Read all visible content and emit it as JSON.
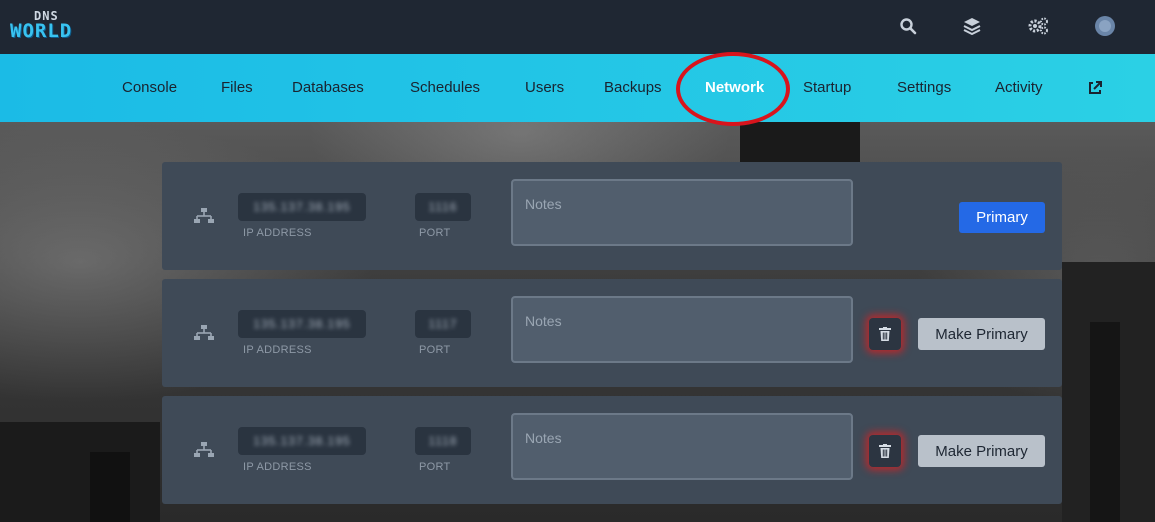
{
  "logo": {
    "line1": "DNS",
    "line2": "WORLD"
  },
  "topbar": {
    "icons": [
      "search-icon",
      "layers-icon",
      "settings-icon",
      "avatar"
    ]
  },
  "nav": {
    "items": [
      {
        "label": "Console"
      },
      {
        "label": "Files"
      },
      {
        "label": "Databases"
      },
      {
        "label": "Schedules"
      },
      {
        "label": "Users"
      },
      {
        "label": "Backups"
      },
      {
        "label": "Network"
      },
      {
        "label": "Startup"
      },
      {
        "label": "Settings"
      },
      {
        "label": "Activity"
      }
    ],
    "active": "Network",
    "external_link_icon": "external-link-icon"
  },
  "allocations": [
    {
      "ip": "135.137.38.195",
      "port": "1116",
      "ip_caption": "IP ADDRESS",
      "port_caption": "PORT",
      "notes_placeholder": "Notes",
      "action_label": "Primary",
      "is_primary": true
    },
    {
      "ip": "135.137.38.195",
      "port": "1117",
      "ip_caption": "IP ADDRESS",
      "port_caption": "PORT",
      "notes_placeholder": "Notes",
      "action_label": "Make Primary",
      "is_primary": false
    },
    {
      "ip": "135.137.38.195",
      "port": "1118",
      "ip_caption": "IP ADDRESS",
      "port_caption": "PORT",
      "notes_placeholder": "Notes",
      "action_label": "Make Primary",
      "is_primary": false
    }
  ],
  "colors": {
    "topbar": "#1f2733",
    "navbar": "#1bbbe6",
    "row": "#3f4a57",
    "primary_button": "#2469e6",
    "make_primary_button": "#b9c1ca",
    "highlight_ring": "#d8141c"
  }
}
